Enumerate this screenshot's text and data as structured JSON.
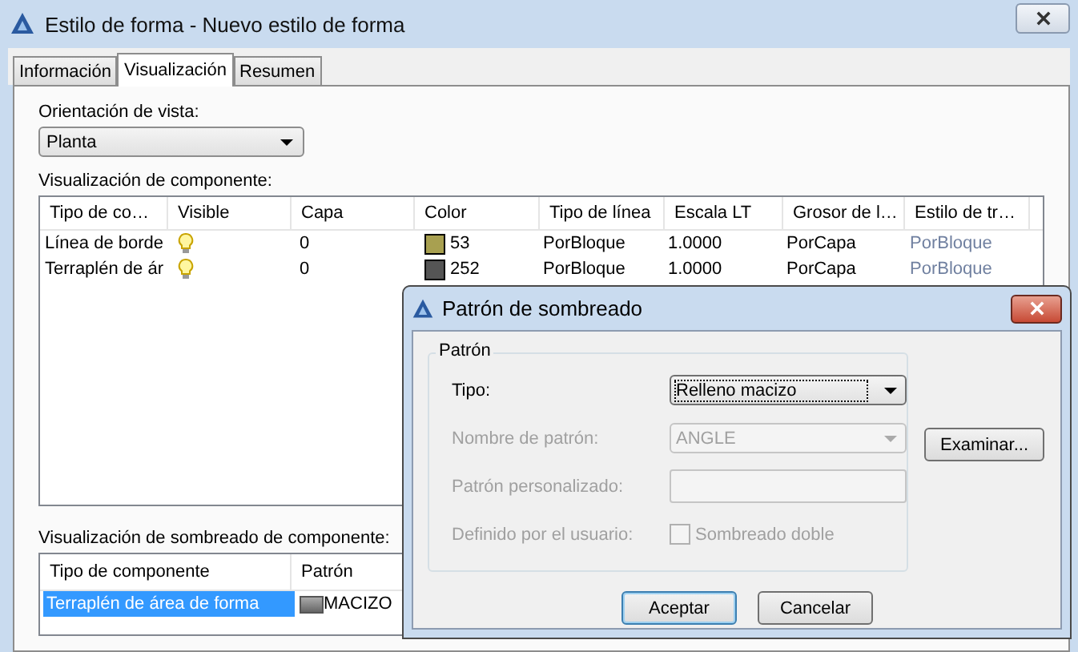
{
  "window": {
    "title": "Estilo de forma - Nuevo estilo de forma"
  },
  "tabs": [
    {
      "label": "Información",
      "selected": false
    },
    {
      "label": "Visualización",
      "selected": true
    },
    {
      "label": "Resumen",
      "selected": false
    }
  ],
  "orientation": {
    "label": "Orientación de vista:",
    "value": "Planta"
  },
  "component_table": {
    "label": "Visualización de componente:",
    "columns": [
      "Tipo de co…",
      "Visible",
      "Capa",
      "Color",
      "Tipo de línea",
      "Escala LT",
      "Grosor de l…",
      "Estilo de tr…"
    ],
    "rows": [
      {
        "name": "Línea de borde",
        "visible": true,
        "layer": "0",
        "color": "#a8a050",
        "color_value": "53",
        "linetype": "PorBloque",
        "lt_scale": "1.0000",
        "lineweight": "PorCapa",
        "plot_style": "PorBloque"
      },
      {
        "name": "Terraplén de ár",
        "visible": true,
        "layer": "0",
        "color": "#555555",
        "color_value": "252",
        "linetype": "PorBloque",
        "lt_scale": "1.0000",
        "lineweight": "PorCapa",
        "plot_style": "PorBloque"
      }
    ]
  },
  "hatch_table": {
    "label": "Visualización de sombreado de componente:",
    "columns": [
      "Tipo de componente",
      "Patrón"
    ],
    "rows": [
      {
        "component": "Terraplén de área de forma",
        "pattern": "MACIZO",
        "selected": true
      }
    ]
  },
  "dialog": {
    "title": "Patrón de sombreado",
    "group": "Patrón",
    "fields": [
      {
        "kind": "dropdown",
        "label": "Tipo:",
        "value": "Relleno macizo",
        "disabled": false
      },
      {
        "kind": "dropdown",
        "label": "Nombre de patrón:",
        "value": "ANGLE",
        "disabled": true
      },
      {
        "kind": "text",
        "label": "Patrón personalizado:",
        "disabled": true
      },
      {
        "kind": "checkbox",
        "label": "Definido por el usuario:",
        "option": "Sombreado doble",
        "checked": false,
        "disabled": true
      }
    ],
    "browse_button": "Examinar...",
    "buttons": [
      {
        "label": "Aceptar",
        "default": true
      },
      {
        "label": "Cancelar",
        "default": false
      }
    ]
  }
}
